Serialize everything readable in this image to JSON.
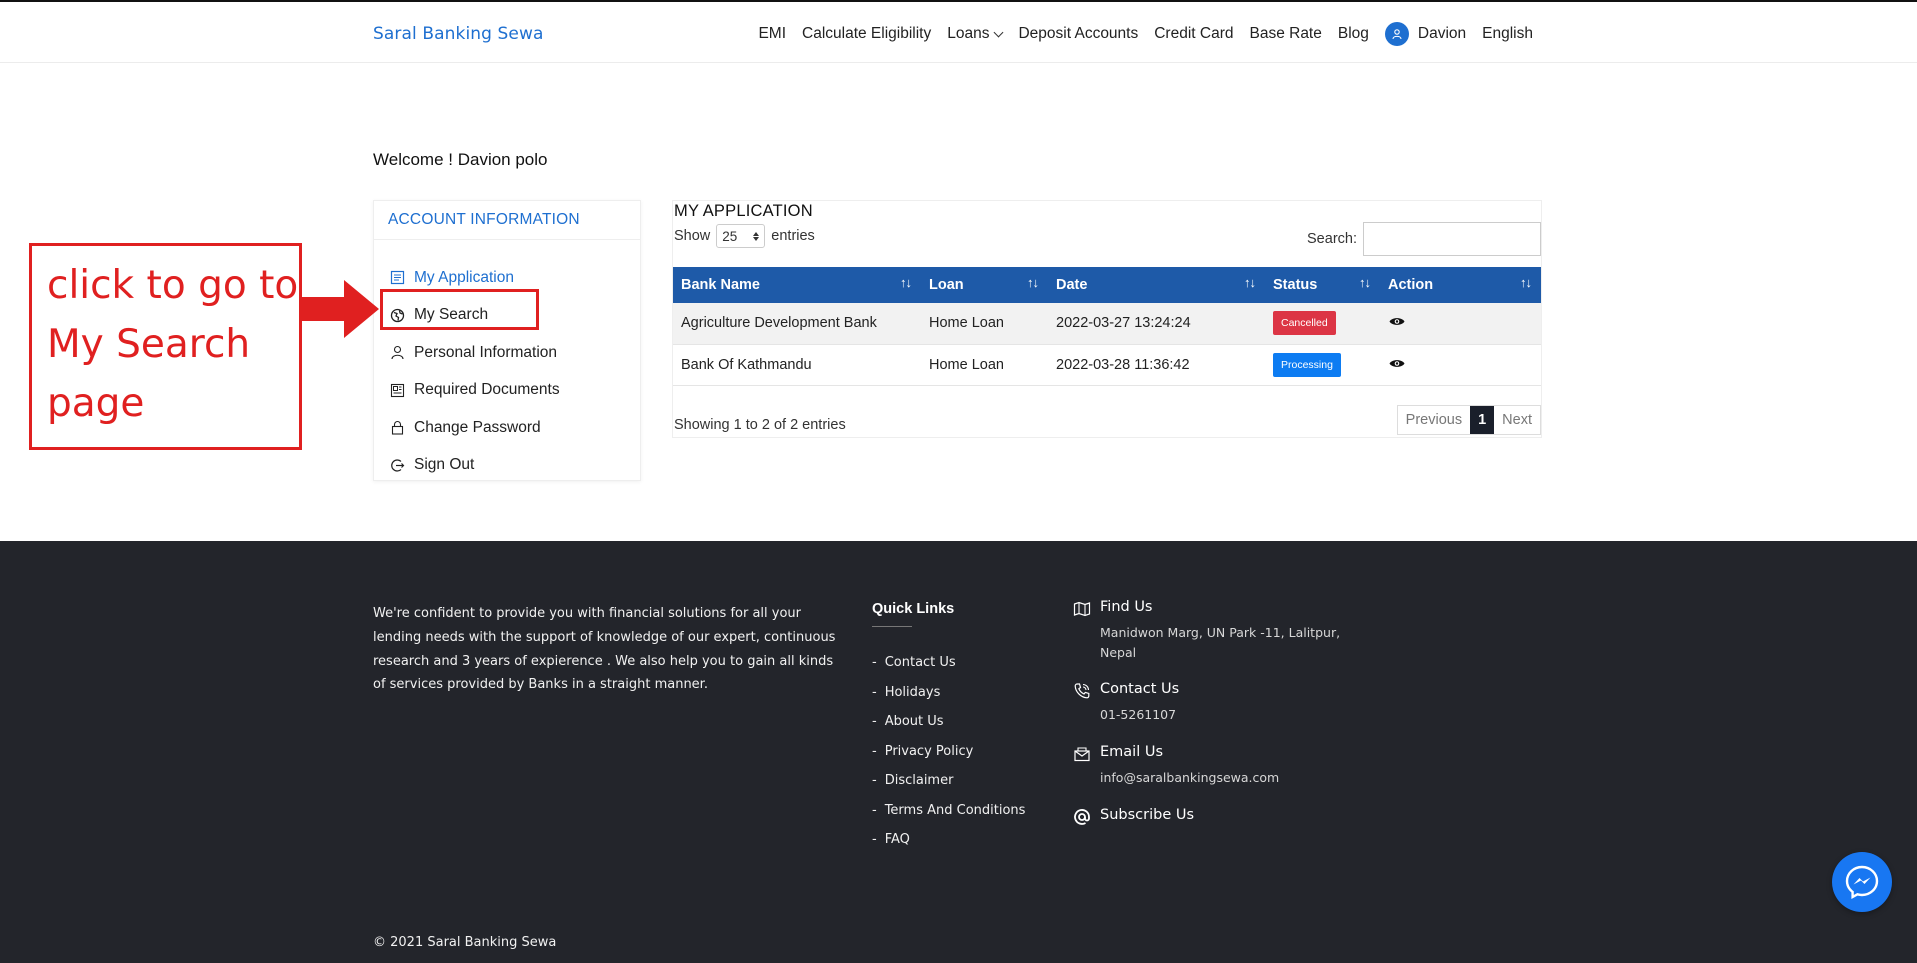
{
  "brand": "Saral Banking Sewa",
  "nav": {
    "items": [
      "EMI",
      "Calculate Eligibility",
      "Loans",
      "Deposit Accounts",
      "Credit Card",
      "Base Rate",
      "Blog"
    ],
    "user": "Davion",
    "language": "English"
  },
  "welcome": "Welcome ! Davion polo",
  "sidebar": {
    "title": "ACCOUNT INFORMATION",
    "items": [
      {
        "label": "My Application",
        "icon": "application-icon",
        "active": true
      },
      {
        "label": "My Search",
        "icon": "globe-icon"
      },
      {
        "label": "Personal Information",
        "icon": "user-icon"
      },
      {
        "label": "Required Documents",
        "icon": "document-icon"
      },
      {
        "label": "Change Password",
        "icon": "lock-icon"
      },
      {
        "label": "Sign Out",
        "icon": "sign-out-icon"
      }
    ]
  },
  "annotation": {
    "text_lines": [
      "click to go to",
      "My Search",
      "page"
    ],
    "color": "#e02020"
  },
  "application": {
    "title": "MY APPLICATION",
    "show_label": "Show",
    "entries_value": "25",
    "entries_label": "entries",
    "search_label": "Search:",
    "columns": [
      "Bank Name",
      "Loan",
      "Date",
      "Status",
      "Action"
    ],
    "rows": [
      {
        "bank": "Agriculture Development Bank",
        "loan": "Home Loan",
        "date": "2022-03-27 13:24:24",
        "status": "Cancelled",
        "status_color": "#dc3545"
      },
      {
        "bank": "Bank Of Kathmandu",
        "loan": "Home Loan",
        "date": "2022-03-28 11:36:42",
        "status": "Processing",
        "status_color": "#0d7cf2"
      }
    ],
    "showing": "Showing 1 to 2 of 2 entries",
    "pager": {
      "previous": "Previous",
      "current": "1",
      "next": "Next"
    }
  },
  "footer": {
    "about": "We're confident to provide you with financial solutions for all your lending needs with the support of knowledge of our expert, continuous research and 3 years of expierence . We also help you to gain all kinds of services provided by Banks in a straight manner.",
    "quick_links_title": "Quick Links",
    "quick_links": [
      "Contact Us",
      "Holidays",
      "About Us",
      "Privacy Policy",
      "Disclaimer",
      "Terms And Conditions",
      "FAQ"
    ],
    "find_us_title": "Find Us",
    "find_us_value": "Manidwon Marg, UN Park -11, Lalitpur, Nepal",
    "contact_title": "Contact Us",
    "contact_value": "01-5261107",
    "email_title": "Email Us",
    "email_value": "info@saralbankingsewa.com",
    "subscribe_title": "Subscribe Us",
    "copyright": "© 2021 Saral Banking Sewa"
  },
  "colors": {
    "brand_blue": "#1e6fd0",
    "table_header": "#1e5aa8",
    "footer_bg": "#23252b",
    "messenger": "#1877f2"
  }
}
